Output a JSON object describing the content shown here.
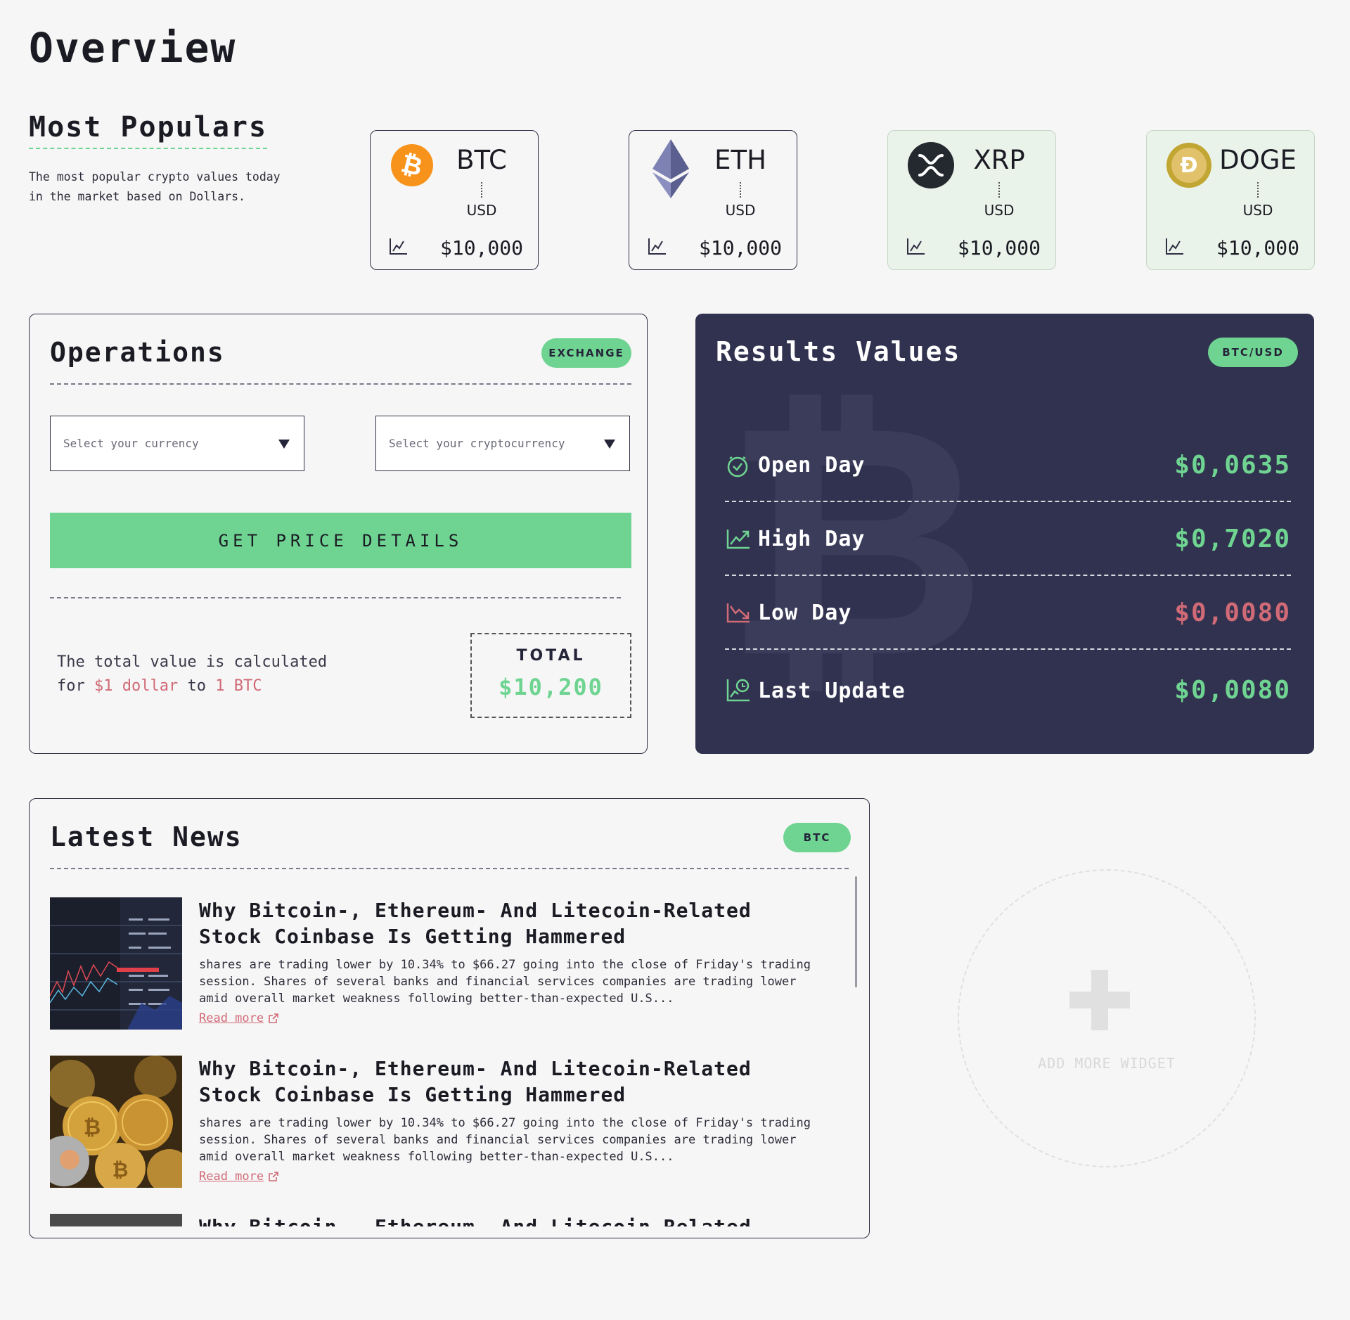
{
  "page": {
    "title": "Overview"
  },
  "popular": {
    "title": "Most Populars",
    "description": "The most popular crypto values today in the market based on Dollars."
  },
  "coins": [
    {
      "symbol": "BTC",
      "quote": "USD",
      "price": "$10,000",
      "logo": "bitcoin-icon",
      "color": "#f7931a"
    },
    {
      "symbol": "ETH",
      "quote": "USD",
      "price": "$10,000",
      "logo": "ethereum-icon",
      "color": "#627eea"
    },
    {
      "symbol": "XRP",
      "quote": "USD",
      "price": "$10,000",
      "logo": "xrp-icon",
      "color": "#23292f"
    },
    {
      "symbol": "DOGE",
      "quote": "USD",
      "price": "$10,000",
      "logo": "dogecoin-icon",
      "color": "#c2a633"
    }
  ],
  "operations": {
    "title": "Operations",
    "badge": "EXCHANGE",
    "currency_placeholder": "Select your currency",
    "crypto_placeholder": "Select your cryptocurrency",
    "button": "GET PRICE DETAILS",
    "note_prefix": "The total value is calculated",
    "note_for": "for",
    "note_amount": "$1 dollar",
    "note_to": "to",
    "note_target": "1 BTC",
    "total_label": "TOTAL",
    "total_value": "$10,200"
  },
  "results": {
    "title": "Results Values",
    "badge": "BTC/USD",
    "watermark": "₿",
    "rows": [
      {
        "label": "Open Day",
        "value": "$0,0635",
        "status": "up",
        "icon": "clock-check-icon"
      },
      {
        "label": "High Day",
        "value": "$0,7020",
        "status": "up",
        "icon": "trend-up-icon"
      },
      {
        "label": "Low Day",
        "value": "$0,0080",
        "status": "down",
        "icon": "trend-down-icon"
      },
      {
        "label": "Last Update",
        "value": "$0,0080",
        "status": "up",
        "icon": "chart-clock-icon"
      }
    ]
  },
  "news": {
    "title": "Latest News",
    "badge": "BTC",
    "items": [
      {
        "title": "Why Bitcoin-, Ethereum- And Litecoin-Related Stock Coinbase Is Getting Hammered",
        "body": "shares are trading lower by 10.34% to $66.27 going into the close of Friday's trading session. Shares of several banks and financial services companies are trading lower amid overall market weakness following better-than-expected U.S...",
        "read_more": "Read more"
      },
      {
        "title": "Why Bitcoin-, Ethereum- And Litecoin-Related Stock Coinbase Is Getting Hammered",
        "body": "shares are trading lower by 10.34% to $66.27 going into the close of Friday's trading session. Shares of several banks and financial services companies are trading lower amid overall market weakness following better-than-expected U.S...",
        "read_more": "Read more"
      },
      {
        "title": "Why Bitcoin-, Ethereum- And Litecoin-Related Stock",
        "body": "",
        "read_more": ""
      }
    ]
  },
  "add_widget": {
    "label": "ADD MORE WIDGET"
  },
  "colors": {
    "accent": "#6fd491",
    "negative": "#d06a76",
    "dark_panel": "#31324f"
  }
}
